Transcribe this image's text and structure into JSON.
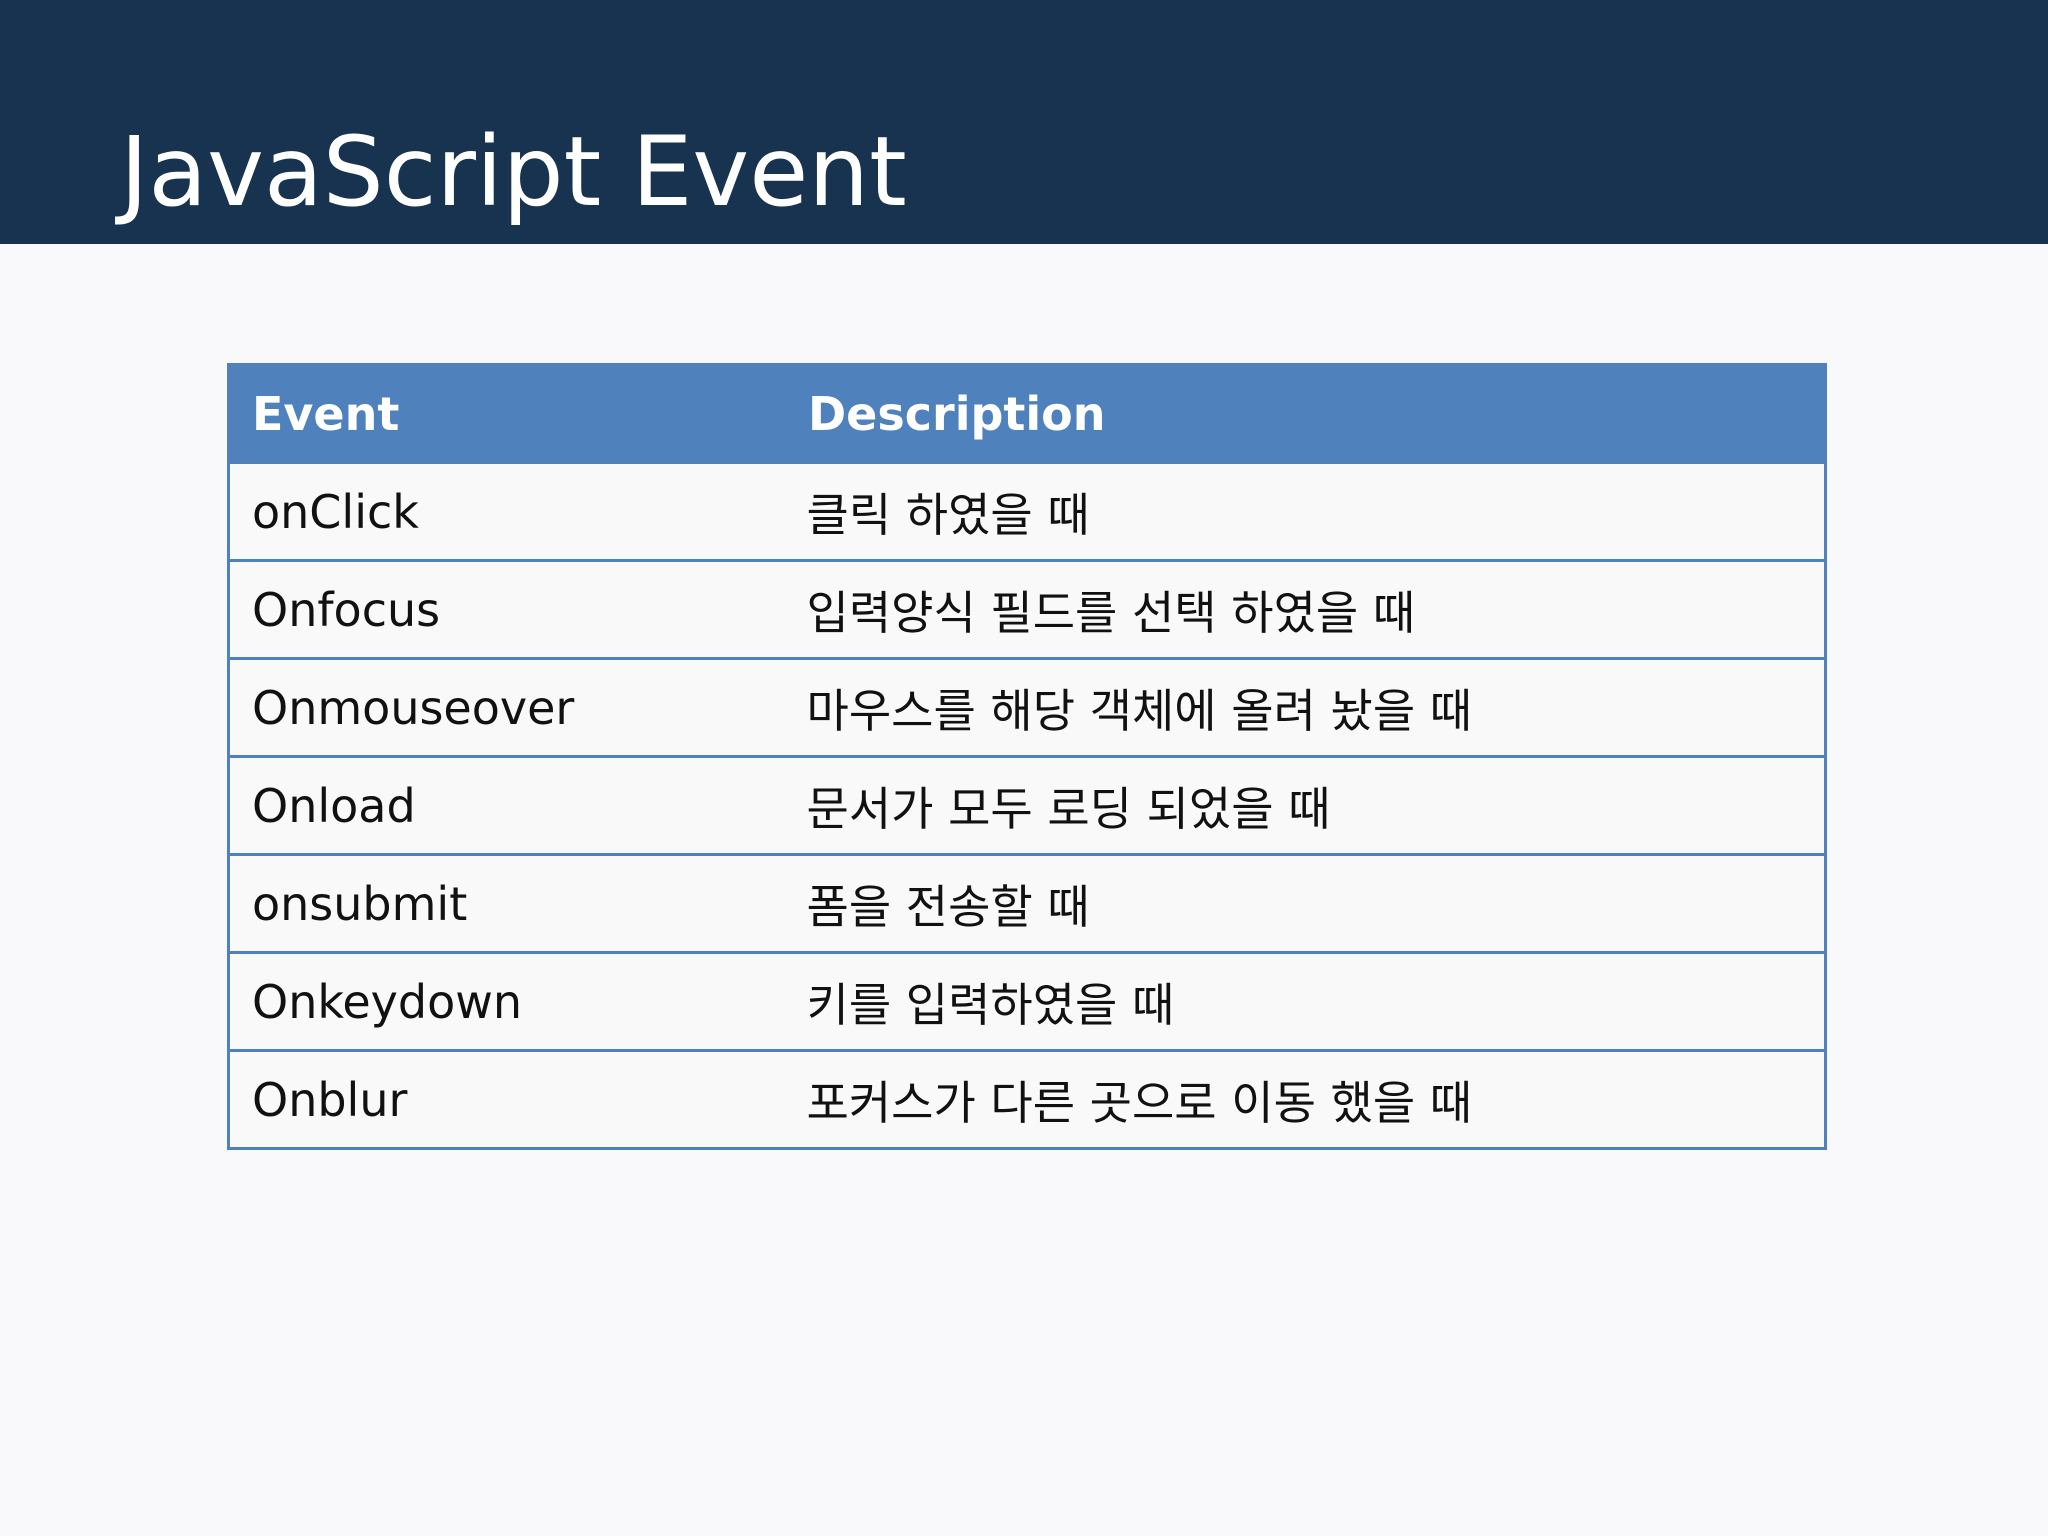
{
  "slide": {
    "title": "JavaScript Event"
  },
  "table": {
    "headers": [
      "Event",
      "Description"
    ],
    "rows": [
      [
        "onClick",
        "클릭 하였을 때"
      ],
      [
        "Onfocus",
        "입력양식 필드를 선택 하였을 때"
      ],
      [
        "Onmouseover",
        "마우스를 해당 객체에 올려 놨을 때"
      ],
      [
        "Onload",
        "문서가 모두 로딩 되었을 때"
      ],
      [
        "onsubmit",
        "폼을 전송할 때"
      ],
      [
        "Onkeydown",
        "키를 입력하였을 때"
      ],
      [
        "Onblur",
        "포커스가 다른 곳으로 이동 했을 때"
      ]
    ]
  },
  "colors": {
    "title_band": "#17334f",
    "table_header": "#4f81bd",
    "table_border": "#4f81bd",
    "background": "#f9f8fb"
  }
}
